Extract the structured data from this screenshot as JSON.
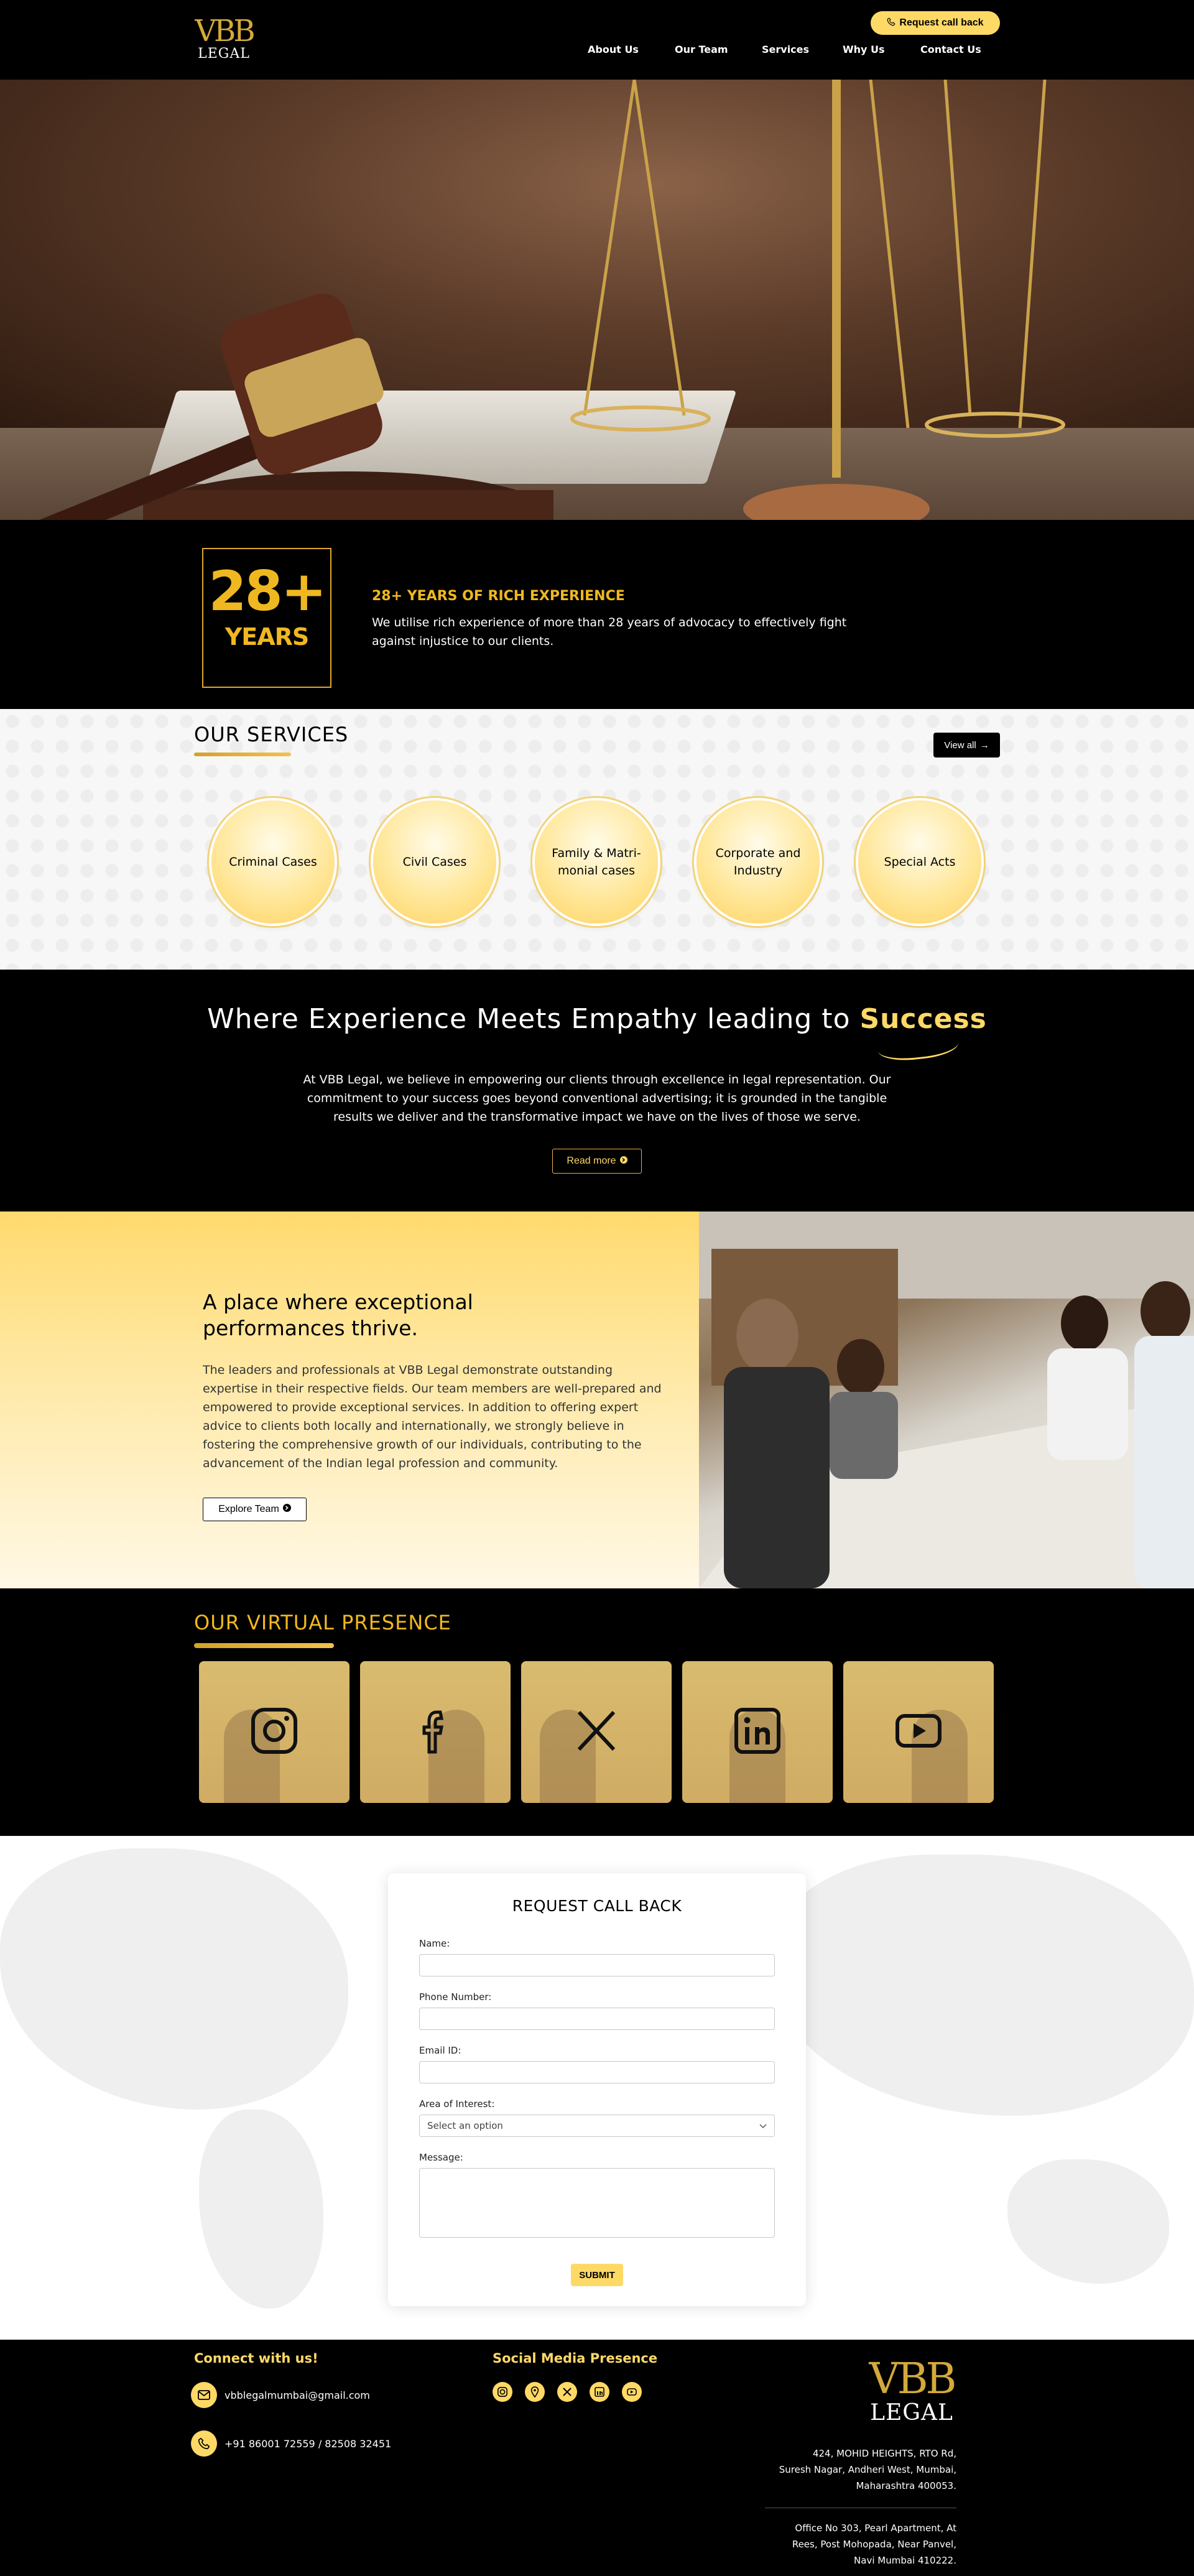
{
  "header": {
    "logo_mark": "VBB",
    "logo_text": "LEGAL",
    "callback_label": "Request call back",
    "nav": [
      "About Us",
      "Our Team",
      "Services",
      "Why Us",
      "Contact Us"
    ]
  },
  "experience": {
    "number": "28+",
    "unit": "YEARS",
    "title": "28+ YEARS OF RICH EXPERIENCE",
    "text": "We utilise rich experience of more than 28 years of advocacy to effectively fight against injustice to our clients."
  },
  "services": {
    "title": "OUR SERVICES",
    "view_all": "View all",
    "items": [
      "Criminal Cases",
      "Civil Cases",
      "Family & Matri-monial cases",
      "Corporate and Industry",
      "Special Acts"
    ]
  },
  "empathy": {
    "title_main": "Where Experience Meets Empathy leading to ",
    "title_highlight": "Success",
    "text": "At VBB Legal, we believe in empowering our clients through excellence in legal representation. Our commitment to your success goes beyond conventional advertising; it is grounded in the tangible results we deliver and the transformative impact we have on the lives of those we serve.",
    "read_more": "Read more"
  },
  "team": {
    "title": "A place where exceptional performances thrive.",
    "text": "The leaders and professionals at VBB Legal demonstrate outstanding expertise in their respective fields. Our team members are well-prepared and empowered to provide exceptional services. In addition to offering expert advice to clients both locally and internationally, we strongly believe in fostering the comprehensive growth of our individuals, contributing to the advancement of the Indian legal profession and community.",
    "explore": "Explore Team"
  },
  "virtual": {
    "title": "OUR VIRTUAL PRESENCE",
    "tiles": [
      "instagram-icon",
      "facebook-icon",
      "x-icon",
      "linkedin-icon",
      "youtube-icon"
    ]
  },
  "form": {
    "title": "REQUEST CALL BACK",
    "name_label": "Name:",
    "phone_label": "Phone Number:",
    "email_label": "Email ID:",
    "area_label": "Area of Interest:",
    "area_selected": "Select an option",
    "message_label": "Message:",
    "submit": "SUBMIT"
  },
  "footer": {
    "connect_title": "Connect with us!",
    "email": "vbblegalmumbai@gmail.com",
    "phone": "+91 86001 72559 / 82508 32451",
    "social_title": "Social Media Presence",
    "social_icons": [
      "instagram-icon",
      "location-icon",
      "x-icon",
      "linkedin-icon",
      "youtube-icon"
    ],
    "address1_line1": "424, MOHID HEIGHTS, RTO Rd,",
    "address1_line2": "Suresh Nagar, Andheri West, Mumbai,",
    "address1_line3": "Maharashtra 400053.",
    "address2_line1": "Office No 303, Pearl Apartment, At",
    "address2_line2": "Rees, Post Mohopada, Near Panvel,",
    "address2_line3": "Navi Mumbai 410222."
  },
  "colors": {
    "accent": "#ffd966",
    "gold": "#f0b820",
    "background": "#000000"
  }
}
